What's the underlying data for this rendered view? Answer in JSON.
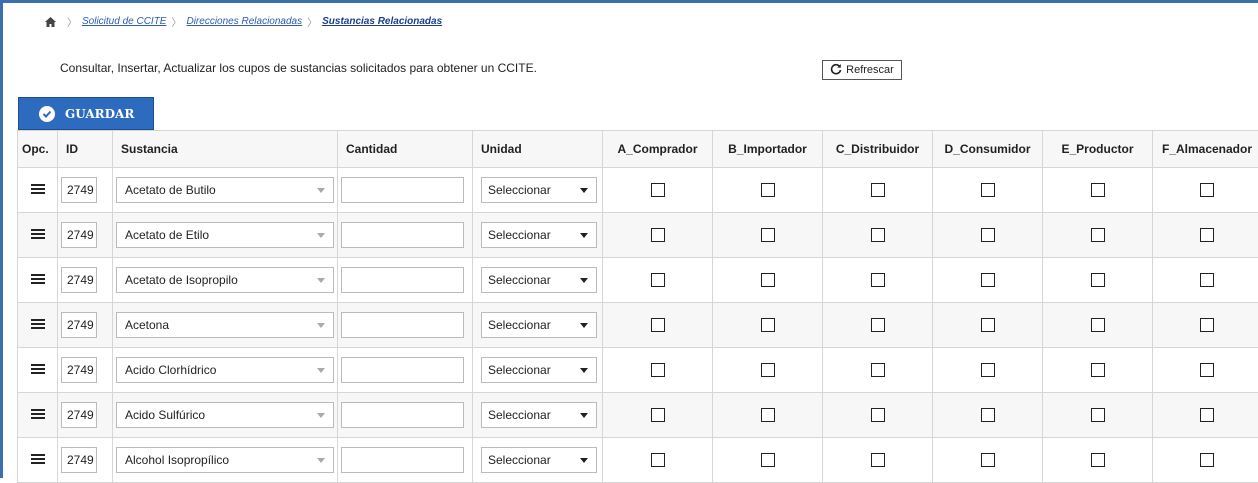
{
  "breadcrumb": {
    "home_icon": "home-icon",
    "items": [
      "Solicitud de CCITE",
      "Direcciones Relacionadas",
      "Sustancias Relacionadas"
    ]
  },
  "description": "Consultar, Insertar, Actualizar los cupos de sustancias solicitados para obtener un CCITE.",
  "toolbar": {
    "refresh_label": "Refrescar",
    "refresh_icon": "refresh-icon",
    "save_label": "GUARDAR",
    "save_icon": "check-circle-icon"
  },
  "table": {
    "headers": {
      "opc": "Opc.",
      "id": "ID",
      "sustancia": "Sustancia",
      "cantidad": "Cantidad",
      "unidad": "Unidad",
      "a": "A_Comprador",
      "b": "B_Importador",
      "c": "C_Distribuidor",
      "d": "D_Consumidor",
      "e": "E_Productor",
      "f": "F_Almacenador"
    },
    "rows": [
      {
        "id": "2749",
        "sustancia": "Acetato de Butilo",
        "cantidad": "",
        "unidad": "Seleccionar"
      },
      {
        "id": "2749",
        "sustancia": "Acetato de Etilo",
        "cantidad": "",
        "unidad": "Seleccionar"
      },
      {
        "id": "2749",
        "sustancia": "Acetato de Isopropilo",
        "cantidad": "",
        "unidad": "Seleccionar"
      },
      {
        "id": "2749",
        "sustancia": "Acetona",
        "cantidad": "",
        "unidad": "Seleccionar"
      },
      {
        "id": "2749",
        "sustancia": "Acido Clorhídrico",
        "cantidad": "",
        "unidad": "Seleccionar"
      },
      {
        "id": "2749",
        "sustancia": "Acido Sulfúrico",
        "cantidad": "",
        "unidad": "Seleccionar"
      },
      {
        "id": "2749",
        "sustancia": "Alcohol Isopropílico",
        "cantidad": "",
        "unidad": "Seleccionar"
      }
    ]
  },
  "colors": {
    "accent": "#2d6bbf",
    "frame": "#3b6fb0",
    "link": "#2a5db0"
  }
}
